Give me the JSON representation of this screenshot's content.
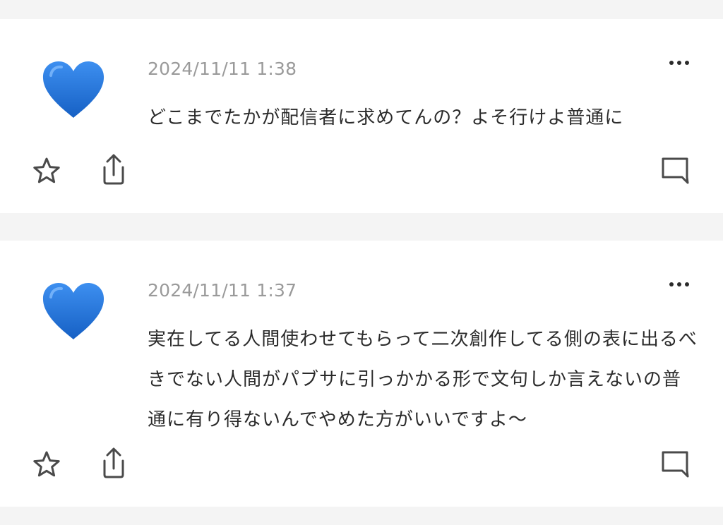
{
  "posts": [
    {
      "avatar_icon": "blue-heart-icon",
      "timestamp": "2024/11/11 1:38",
      "text": "どこまでたかが配信者に求めてんの？よそ行けよ普通に"
    },
    {
      "avatar_icon": "blue-heart-icon",
      "timestamp": "2024/11/11 1:37",
      "text": "実在してる人間使わせてもらって二次創作してる側の表に出るべきでない人間がパブサに引っかかる形で文句しか言えないの普通に有り得ないんでやめた方がいいですよ〜"
    }
  ],
  "colors": {
    "heart": "#1e74d6",
    "heart_highlight": "#4f9cf0",
    "icon_stroke": "#4a4a4a",
    "timestamp": "#9a9a9a",
    "background": "#f4f4f4",
    "card": "#ffffff"
  }
}
